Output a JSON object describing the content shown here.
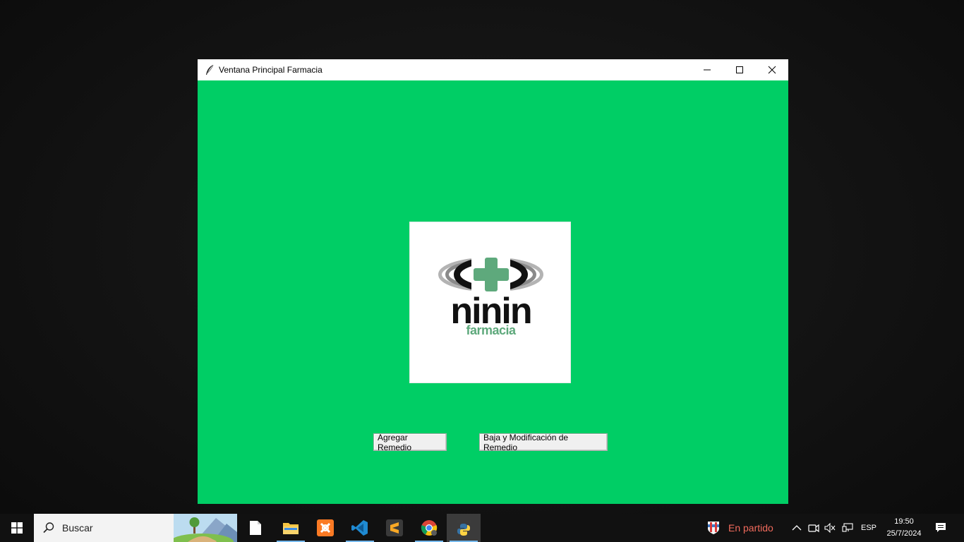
{
  "window": {
    "title": "Ventana Principal Farmacia",
    "background_color": "#00ce65",
    "controls": {
      "minimize_icon": "minimize-icon",
      "maximize_icon": "maximize-icon",
      "close_icon": "close-icon"
    }
  },
  "logo": {
    "brand": "ninin",
    "subtitle": "farmacia",
    "cross_color": "#5ea97c"
  },
  "buttons": {
    "add": "Agregar Remedio",
    "modify": "Baja y Modificación de Remedio"
  },
  "taskbar": {
    "search_placeholder": "Buscar",
    "apps": [
      "file-icon",
      "file-explorer-icon",
      "xampp-icon",
      "vscode-icon",
      "sublime-text-icon",
      "chrome-icon",
      "python-icon"
    ],
    "weather_text": "En partido",
    "language": "ESP",
    "time": "19:50",
    "date": "25/7/2024"
  }
}
